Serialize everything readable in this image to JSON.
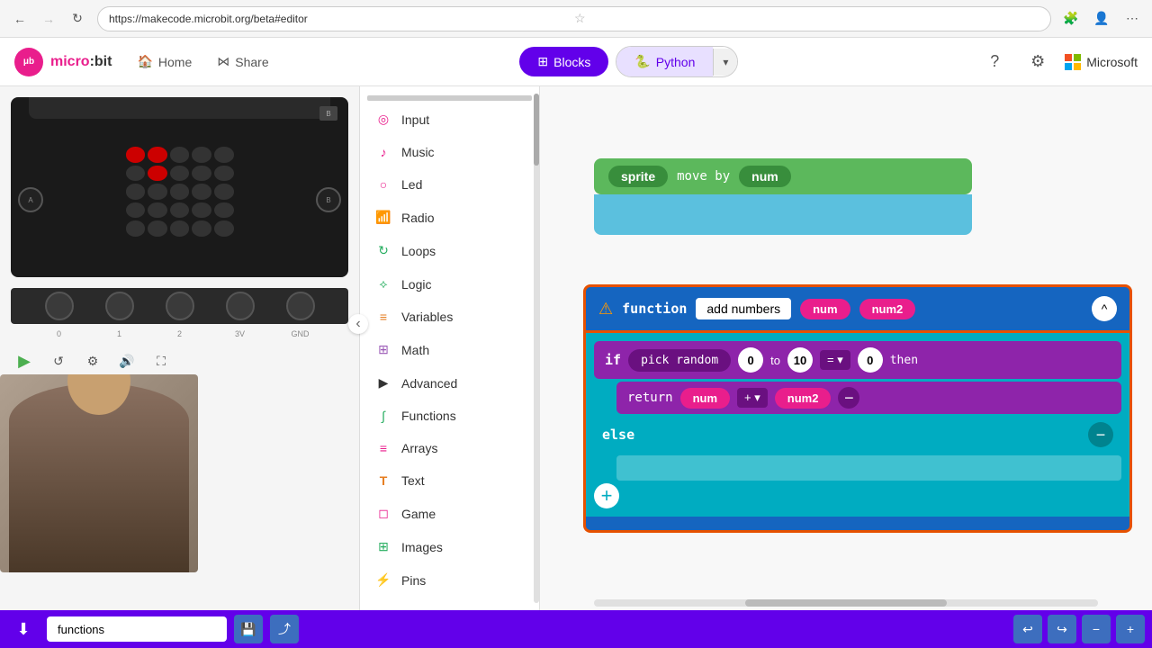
{
  "browser": {
    "url": "https://makecode.microbit.org/beta#editor",
    "back_disabled": false,
    "forward_disabled": true
  },
  "header": {
    "logo_text": "micro:bit",
    "home_label": "Home",
    "share_label": "Share",
    "blocks_label": "Blocks",
    "python_label": "Python",
    "help_icon": "?",
    "settings_icon": "⚙"
  },
  "sidebar": {
    "items": [
      {
        "id": "input",
        "label": "Input",
        "icon": "◎",
        "color": "#e91e8c"
      },
      {
        "id": "music",
        "label": "Music",
        "icon": "♪",
        "color": "#e91e8c"
      },
      {
        "id": "led",
        "label": "Led",
        "icon": "○",
        "color": "#e91e8c"
      },
      {
        "id": "radio",
        "label": "Radio",
        "icon": "📶",
        "color": "#e91e8c"
      },
      {
        "id": "loops",
        "label": "Loops",
        "icon": "↻",
        "color": "#27ae60"
      },
      {
        "id": "logic",
        "label": "Logic",
        "icon": "⟡",
        "color": "#27ae60"
      },
      {
        "id": "variables",
        "label": "Variables",
        "icon": "≡",
        "color": "#e67e22"
      },
      {
        "id": "math",
        "label": "Math",
        "icon": "⊞",
        "color": "#9b59b6"
      },
      {
        "id": "advanced",
        "label": "Advanced",
        "icon": "▶",
        "color": "#333"
      },
      {
        "id": "functions",
        "label": "Functions",
        "icon": "∫",
        "color": "#27ae60"
      },
      {
        "id": "arrays",
        "label": "Arrays",
        "icon": "≡",
        "color": "#e91e8c"
      },
      {
        "id": "text",
        "label": "Text",
        "icon": "T",
        "color": "#e67e22"
      },
      {
        "id": "game",
        "label": "Game",
        "icon": "◻",
        "color": "#e91e8c"
      },
      {
        "id": "images",
        "label": "Images",
        "icon": "⊞",
        "color": "#27ae60"
      },
      {
        "id": "pins",
        "label": "Pins",
        "icon": "⚡",
        "color": "#e91e8c"
      }
    ]
  },
  "blocks": {
    "function_name": "add numbers",
    "param1": "num",
    "param2": "num2",
    "pick_random_label": "pick random",
    "pick_random_from": "0",
    "pick_random_to_label": "to",
    "pick_random_to": "10",
    "compare_value": "0",
    "return_label": "return",
    "plus_label": "+",
    "else_label": "else",
    "if_label": "if",
    "then_label": "then",
    "function_keyword": "function"
  },
  "sprites": {
    "sprite_label": "sprite",
    "move_label": "move by",
    "num_label": "num"
  },
  "microbit": {
    "pin_labels": [
      "0",
      "1",
      "2",
      "3V",
      "GND"
    ]
  },
  "bottom_bar": {
    "search_placeholder": "functions",
    "search_value": "functions"
  }
}
